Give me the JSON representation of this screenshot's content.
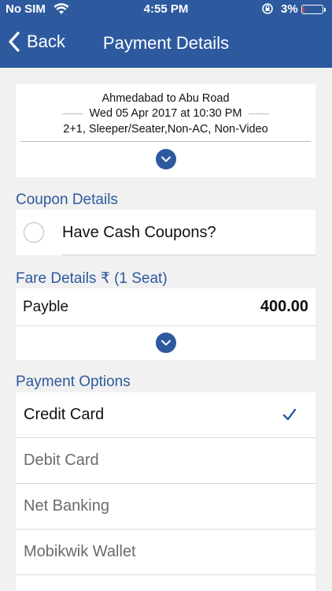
{
  "status_bar": {
    "carrier": "No SIM",
    "time": "4:55 PM",
    "battery_text": "3%",
    "battery_level": 0.03
  },
  "nav": {
    "back_label": "Back",
    "title": "Payment Details"
  },
  "trip": {
    "route": "Ahmedabad to Abu Road",
    "date": "Wed 05 Apr 2017 at 10:30 PM",
    "bus_class": "2+1, Sleeper/Seater,Non-AC, Non-Video"
  },
  "coupon": {
    "section_title": "Coupon Details",
    "label": "Have Cash Coupons?"
  },
  "fare": {
    "section_title": "Fare Details ₹ (1 Seat)",
    "label": "Payble",
    "value": "400.00"
  },
  "payment": {
    "section_title": "Payment Options",
    "options": [
      {
        "label": "Credit Card",
        "selected": true,
        "color": "#111111"
      },
      {
        "label": "Debit Card",
        "selected": false,
        "color": "#6b6b6b"
      },
      {
        "label": "Net Banking",
        "selected": false,
        "color": "#6b6b6b"
      },
      {
        "label": "Mobikwik Wallet",
        "selected": false,
        "color": "#6b6b6b"
      }
    ]
  },
  "colors": {
    "primary": "#2d5a9e",
    "battery_low": "#e53935"
  }
}
